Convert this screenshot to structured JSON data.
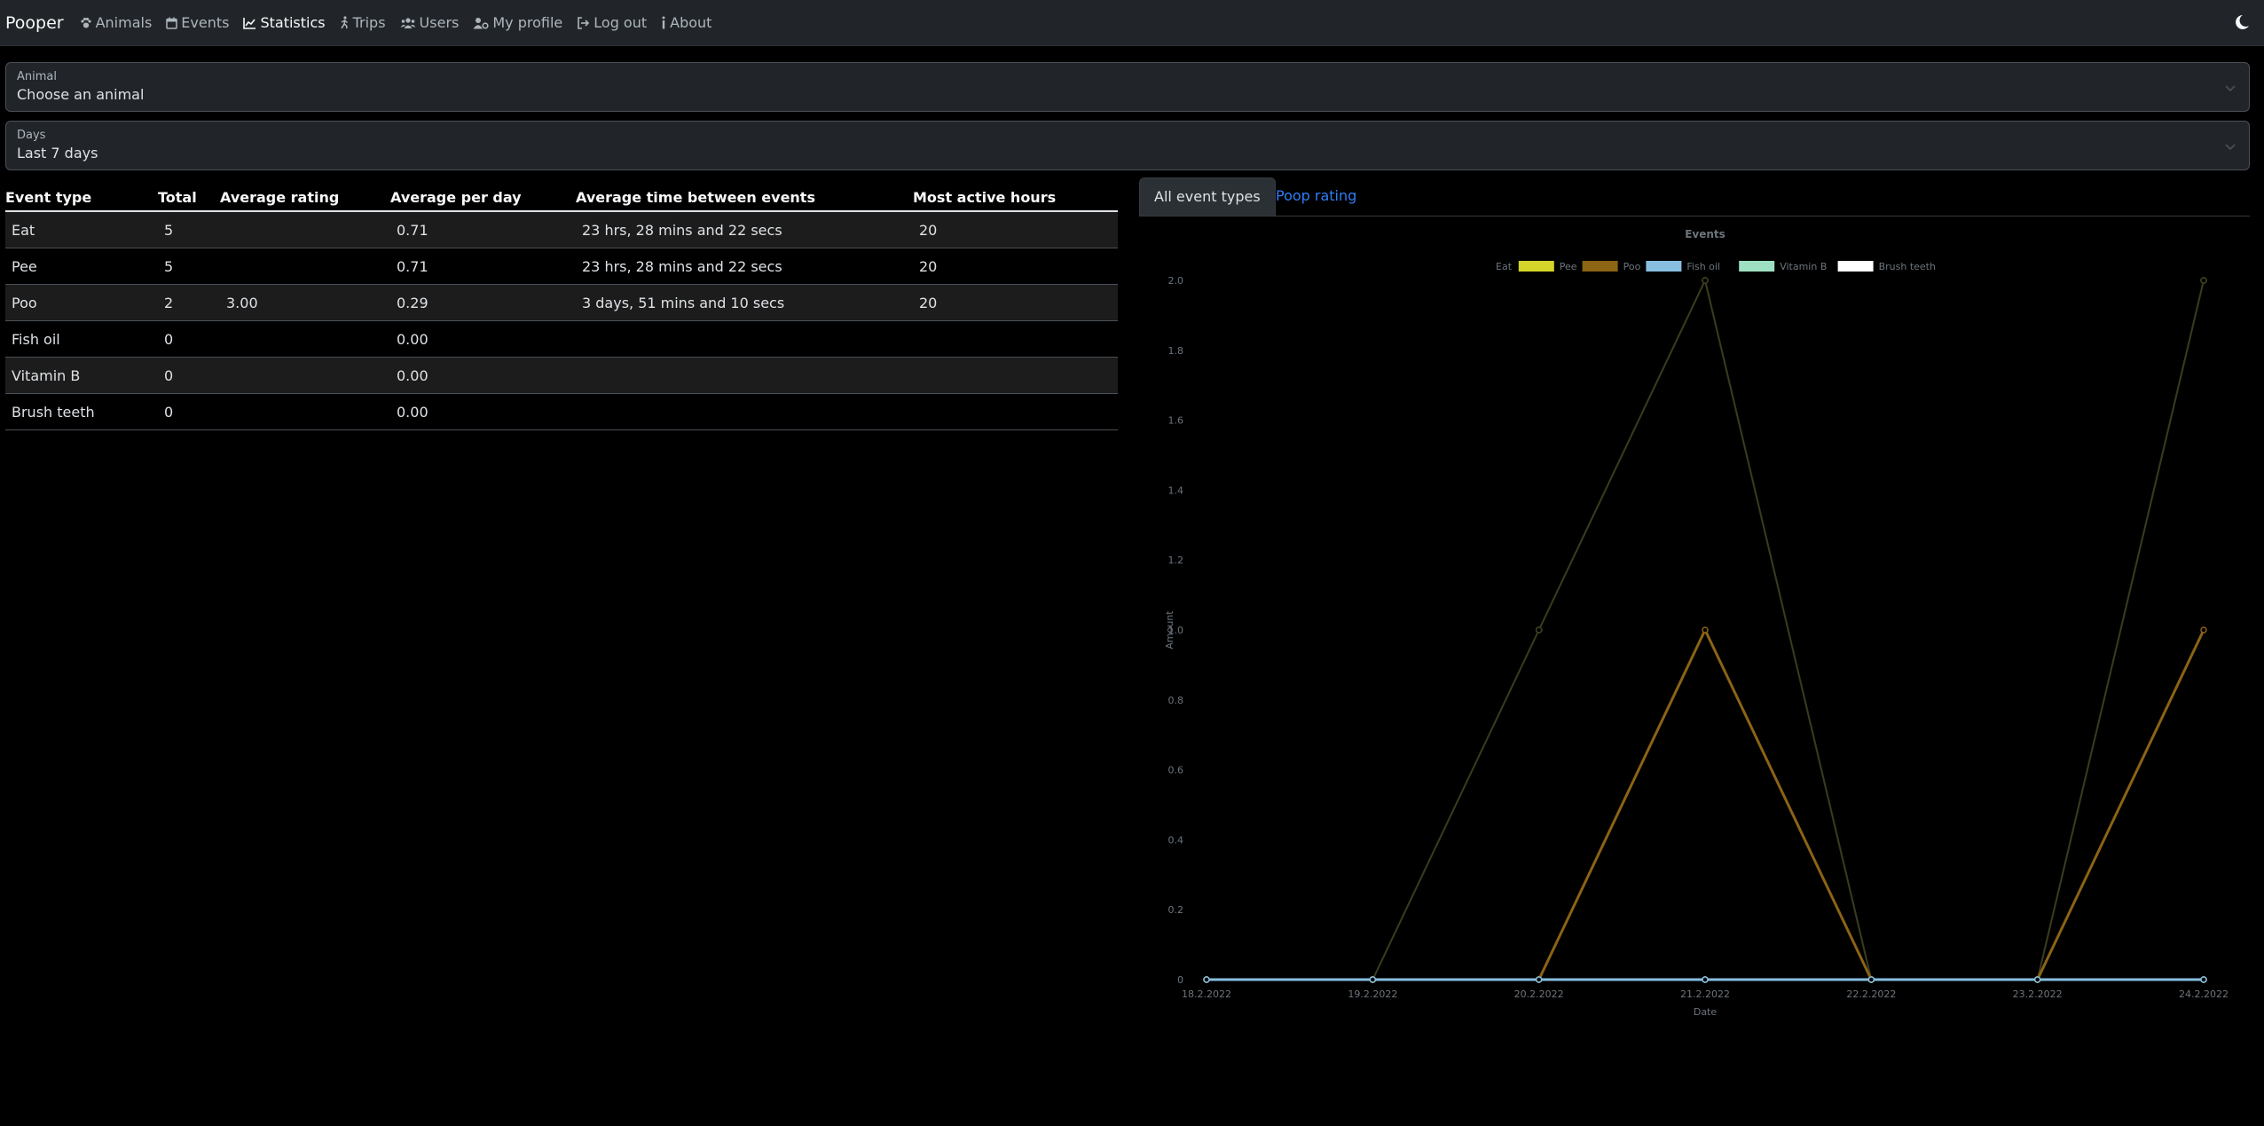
{
  "app": {
    "brand": "Pooper",
    "nav": [
      {
        "label": "Animals",
        "icon": "paw-icon",
        "active": false
      },
      {
        "label": "Events",
        "icon": "calendar-icon",
        "active": false
      },
      {
        "label": "Statistics",
        "icon": "line-chart-icon",
        "active": true
      },
      {
        "label": "Trips",
        "icon": "walking-person-icon",
        "active": false
      },
      {
        "label": "Users",
        "icon": "users-icon",
        "active": false
      },
      {
        "label": "My profile",
        "icon": "user-cog-icon",
        "active": false
      },
      {
        "label": "Log out",
        "icon": "sign-out-icon",
        "active": false
      },
      {
        "label": "About",
        "icon": "info-icon",
        "active": false
      }
    ],
    "theme_toggle_icon": "moon-icon"
  },
  "filters": {
    "animal": {
      "label": "Animal",
      "value": "Choose an animal"
    },
    "days": {
      "label": "Days",
      "value": "Last 7 days"
    }
  },
  "table": {
    "headers": [
      "Event type",
      "Total",
      "Average rating",
      "Average per day",
      "Average time between events",
      "Most active hours"
    ],
    "rows": [
      [
        "Eat",
        "5",
        "",
        "0.71",
        "23 hrs, 28 mins and 22 secs",
        "20"
      ],
      [
        "Pee",
        "5",
        "",
        "0.71",
        "23 hrs, 28 mins and 22 secs",
        "20"
      ],
      [
        "Poo",
        "2",
        "3.00",
        "0.29",
        "3 days, 51 mins and 10 secs",
        "20"
      ],
      [
        "Fish oil",
        "0",
        "",
        "0.00",
        "",
        ""
      ],
      [
        "Vitamin B",
        "0",
        "",
        "0.00",
        "",
        ""
      ],
      [
        "Brush teeth",
        "0",
        "",
        "0.00",
        "",
        ""
      ]
    ]
  },
  "tabs": [
    {
      "label": "All event types",
      "active": true
    },
    {
      "label": "Poop rating",
      "active": false
    }
  ],
  "colors": {
    "eat": "#3a3a1f",
    "pee": "#d4d42a",
    "poo": "#8b6414",
    "fish_oil": "#87bfe0",
    "vitamin_b": "#9ee0c2",
    "brush_teeth": "#ffffff",
    "link": "#2f7ef7"
  },
  "chart_data": {
    "type": "line",
    "title": "Events",
    "xlabel": "Date",
    "ylabel": "Amount",
    "x": [
      "18.2.2022",
      "19.2.2022",
      "20.2.2022",
      "21.2.2022",
      "22.2.2022",
      "23.2.2022",
      "24.2.2022"
    ],
    "ylim": [
      0,
      2
    ],
    "yticks": [
      "0",
      "0.2",
      "0.4",
      "0.6",
      "0.8",
      "1.0",
      "1.2",
      "1.4",
      "1.6",
      "1.8",
      "2.0"
    ],
    "legend_position": "top",
    "series": [
      {
        "name": "Eat",
        "color": "#3a3a1f",
        "values": [
          0,
          0,
          1,
          2,
          0,
          0,
          2
        ]
      },
      {
        "name": "Pee",
        "color": "#d4d42a",
        "values": [
          0,
          0,
          1,
          2,
          0,
          0,
          2
        ]
      },
      {
        "name": "Poo",
        "color": "#8b6414",
        "values": [
          0,
          0,
          0,
          1,
          0,
          0,
          1
        ]
      },
      {
        "name": "Fish oil",
        "color": "#87bfe0",
        "values": [
          0,
          0,
          0,
          0,
          0,
          0,
          0
        ]
      },
      {
        "name": "Vitamin B",
        "color": "#9ee0c2",
        "values": [
          0,
          0,
          0,
          0,
          0,
          0,
          0
        ]
      },
      {
        "name": "Brush teeth",
        "color": "#ffffff",
        "values": [
          0,
          0,
          0,
          0,
          0,
          0,
          0
        ]
      }
    ]
  }
}
